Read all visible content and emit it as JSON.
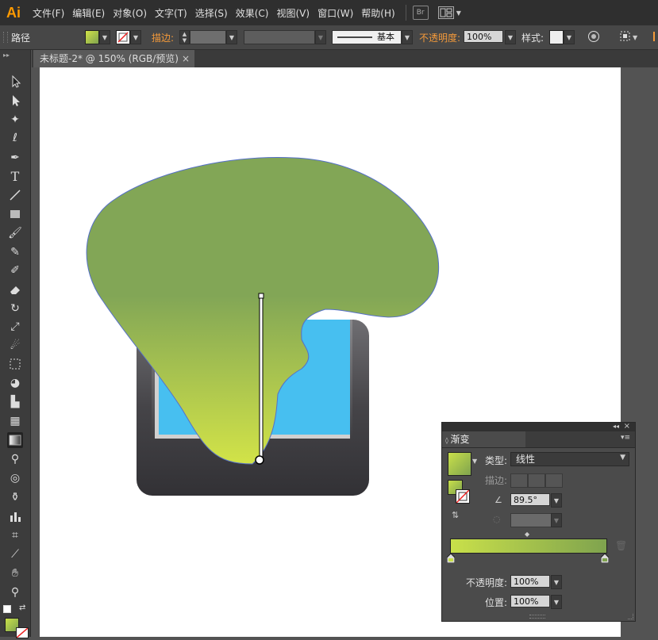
{
  "app": {
    "logo": "Ai"
  },
  "menu": [
    "文件(F)",
    "编辑(E)",
    "对象(O)",
    "文字(T)",
    "选择(S)",
    "效果(C)",
    "视图(V)",
    "窗口(W)",
    "帮助(H)"
  ],
  "menu_extra": {
    "bridge_label": "Br"
  },
  "control_bar": {
    "selection_type": "路径",
    "stroke_label": "描边:",
    "stroke_style": "基本",
    "opacity_label": "不透明度:",
    "opacity_value": "100%",
    "style_label": "样式:"
  },
  "document_tab": {
    "title": "未标题-2* @ 150% (RGB/预览)",
    "close": "×"
  },
  "tools": [
    "selection-tool",
    "direct-selection-tool",
    "magic-wand-tool",
    "lasso-tool",
    "pen-tool",
    "type-tool",
    "line-tool",
    "rectangle-tool",
    "paintbrush-tool",
    "pencil-tool",
    "blob-brush-tool",
    "eraser-tool",
    "rotate-tool",
    "scale-tool",
    "warp-tool",
    "free-transform-tool",
    "shape-builder-tool",
    "graph-tool",
    "mesh-tool",
    "gradient-tool",
    "eyedropper-tool",
    "blend-tool",
    "symbol-sprayer-tool",
    "column-graph-tool",
    "artboard-tool",
    "slice-tool",
    "hand-tool",
    "zoom-tool"
  ],
  "gradient_panel": {
    "title": "渐变",
    "type_label": "类型:",
    "type_value": "线性",
    "stroke_label": "描边:",
    "angle_value": "89.5°",
    "opacity_label": "不透明度:",
    "opacity_value": "100%",
    "location_label": "位置:",
    "location_value": "100%",
    "colors": {
      "start": "#c9e04a",
      "end": "#7fa34e"
    }
  },
  "artwork": {
    "shape_gradient": {
      "top": "#82a656",
      "bottom": "#d2e348"
    },
    "screen_color": "#47bff0",
    "device_color": "#3d3c3f"
  }
}
